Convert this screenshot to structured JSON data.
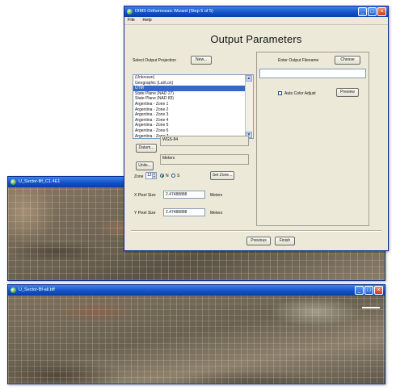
{
  "wizard": {
    "title": "DIMS Orthomosaic Wizard (Step 5 of 5)",
    "menu": [
      "File",
      "Help"
    ],
    "heading": "Output Parameters",
    "projection_label": "Select Output Projection",
    "projection_new_button": "New...",
    "projection_items": [
      "(Unknown)",
      "Geographic (Lat/Lon)",
      "UTM",
      "State Plane (NAD 27)",
      "State Plane (NAD 83)",
      "Argentina - Zone 1",
      "Argentina - Zone 2",
      "Argentina - Zone 3",
      "Argentina - Zone 4",
      "Argentina - Zone 5",
      "Argentina - Zone 6",
      "Argentina - Zone 7"
    ],
    "projection_selected": "UTM",
    "datum_button": "Datum...",
    "datum_value": "WGS-84",
    "units_button": "Units...",
    "units_value": "Meters",
    "zone_label": "Zone",
    "zone_value": "12",
    "hemisphere_n": "N",
    "hemisphere_s": "S",
    "set_zone_button": "Set Zone...",
    "x_pixel_label": "X Pixel Size",
    "x_pixel_value": "2.47488888",
    "x_pixel_unit": "Meters",
    "y_pixel_label": "Y Pixel Size",
    "y_pixel_value": "2.47488888",
    "y_pixel_unit": "Meters",
    "output_filename_label": "Enter Output Filename",
    "choose_button": "Choose",
    "output_filename_value": "",
    "auto_color_label": "Auto Color Adjust",
    "preview_button": "Preview",
    "previous_button": "Previous",
    "finish_button": "Finish"
  },
  "image_window_1": {
    "title": "U_Sector-Bf_C1.4E1"
  },
  "image_window_2": {
    "title": "U_Sector-Bf-all.bff"
  },
  "colors": {
    "title_bar": "#1452c8",
    "dialog_face": "#ece9d8",
    "selection": "#316ac5"
  }
}
